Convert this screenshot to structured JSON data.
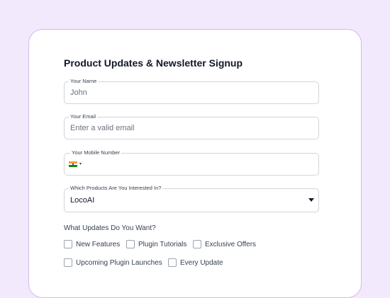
{
  "form": {
    "title": "Product Updates & Newsletter Signup",
    "name": {
      "label": "Your Name",
      "placeholder": "John"
    },
    "email": {
      "label": "Your Email",
      "placeholder": "Enter a valid email"
    },
    "mobile": {
      "label": "Your Mobile Number",
      "country_flag": "india-flag-icon",
      "caret": "▾"
    },
    "products": {
      "label": "Which Products Are You Interested In?",
      "selected": "LocoAI"
    },
    "updates_question": "What Updates Do You Want?",
    "update_options": [
      {
        "label": "New Features",
        "checked": false
      },
      {
        "label": "Plugin Tutorials",
        "checked": false
      },
      {
        "label": "Exclusive Offers",
        "checked": false
      },
      {
        "label": "Upcoming Plugin Launches",
        "checked": false
      },
      {
        "label": "Every Update",
        "checked": false
      }
    ]
  },
  "colors": {
    "page_background": "#f3e9fc",
    "card_border": "#d9b8ee",
    "title_text": "#111827"
  }
}
